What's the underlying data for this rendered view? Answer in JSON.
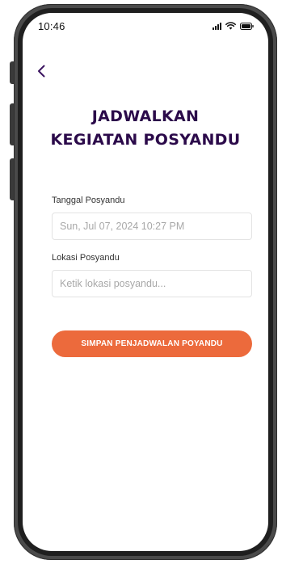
{
  "status_bar": {
    "time": "10:46",
    "icons": [
      "signal-icon",
      "wifi-icon",
      "battery-icon"
    ]
  },
  "nav": {
    "back_icon": "chevron-left-icon"
  },
  "title": {
    "line1": "JADWALKAN",
    "line2": "KEGIATAN POSYANDU"
  },
  "form": {
    "date_label": "Tanggal Posyandu",
    "date_value": "Sun, Jul 07, 2024 10:27 PM",
    "location_label": "Lokasi Posyandu",
    "location_placeholder": "Ketik lokasi posyandu...",
    "submit_label": "SIMPAN PENJADWALAN POYANDU"
  },
  "colors": {
    "title": "#2b0a4a",
    "accent": "#ec6a3c",
    "back_icon": "#3b1460",
    "phone_frame": "#4a4a4a"
  }
}
